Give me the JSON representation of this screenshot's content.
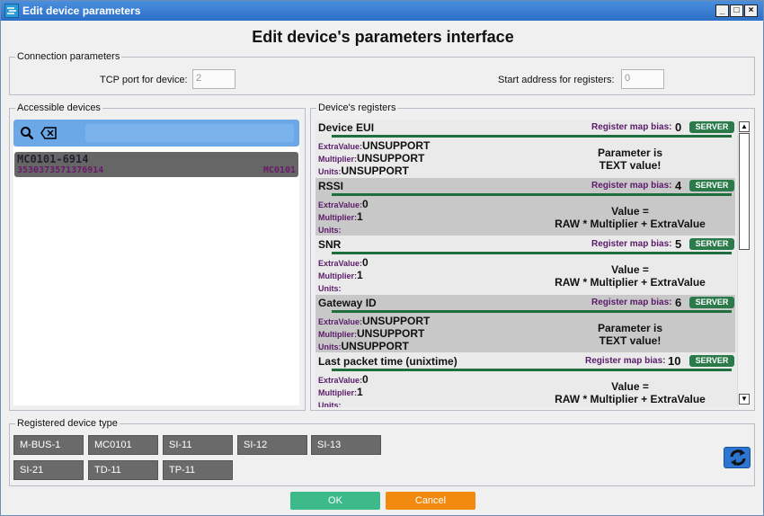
{
  "window": {
    "title": "Edit device parameters",
    "minimize": "_",
    "maximize": "□",
    "close": "×"
  },
  "header": {
    "title": "Edit device's parameters interface"
  },
  "connection": {
    "legend": "Connection parameters",
    "tcp_label": "TCP port for device:",
    "tcp_value": "2",
    "start_label": "Start address for registers:",
    "start_value": "0"
  },
  "devices": {
    "legend": "Accessible devices",
    "search_icon": "search-icon",
    "clear_icon": "backspace-icon",
    "items": [
      {
        "name": "MC0101-6914",
        "id": "3530373571376914",
        "model": "MC0101"
      }
    ]
  },
  "registers": {
    "legend": "Device's registers",
    "bias_label": "Register map bias:",
    "server_label": "SERVER",
    "extra_key": "ExtraValue:",
    "mult_key": "Multiplier:",
    "units_key": "Units:",
    "items": [
      {
        "name": "Device EUI",
        "bias": "0",
        "extra": "UNSUPPORT",
        "mult": "UNSUPPORT",
        "units": "UNSUPPORT",
        "note1": "Parameter is",
        "note2": "TEXT value!"
      },
      {
        "name": "RSSI",
        "bias": "4",
        "extra": "0",
        "mult": "1",
        "units": "",
        "note1": "Value =",
        "note2": "RAW * Multiplier + ExtraValue"
      },
      {
        "name": "SNR",
        "bias": "5",
        "extra": "0",
        "mult": "1",
        "units": "",
        "note1": "Value =",
        "note2": "RAW * Multiplier + ExtraValue"
      },
      {
        "name": "Gateway ID",
        "bias": "6",
        "extra": "UNSUPPORT",
        "mult": "UNSUPPORT",
        "units": "UNSUPPORT",
        "note1": "Parameter is",
        "note2": "TEXT value!"
      },
      {
        "name": "Last packet time (unixtime)",
        "bias": "10",
        "extra": "0",
        "mult": "1",
        "units": "",
        "note1": "Value =",
        "note2": "RAW * Multiplier + ExtraValue"
      }
    ]
  },
  "types": {
    "legend": "Registered device type",
    "items": [
      "M-BUS-1",
      "MC0101",
      "SI-11",
      "SI-12",
      "SI-13",
      "SI-21",
      "TD-11",
      "TP-11"
    ]
  },
  "footer": {
    "ok": "OK",
    "cancel": "Cancel"
  }
}
